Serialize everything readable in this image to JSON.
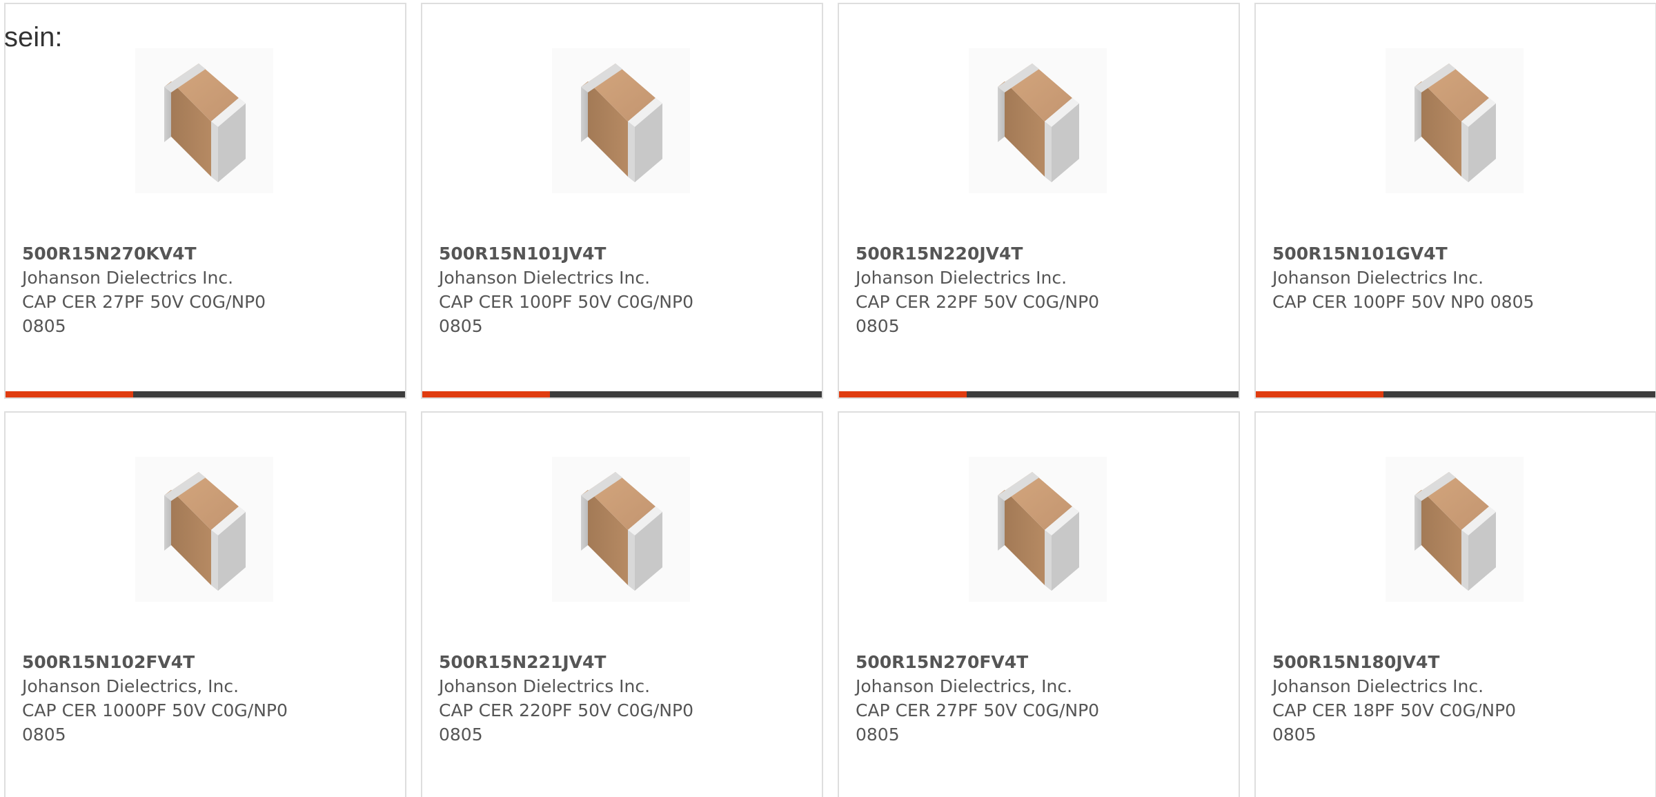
{
  "intro_text": "sein:",
  "colors": {
    "accent": "#e03c10",
    "track": "#3d3d3d",
    "border": "#dedede",
    "text": "#555555"
  },
  "product_image_icon": "ceramic-capacitor-chip",
  "products": [
    {
      "part_number": "500R15N270KV4T",
      "manufacturer": "Johanson Dielectrics Inc.",
      "description": "CAP CER 27PF 50V C0G/NP0 0805",
      "progress_fraction": 0.32
    },
    {
      "part_number": "500R15N101JV4T",
      "manufacturer": "Johanson Dielectrics Inc.",
      "description": "CAP CER 100PF 50V C0G/NP0 0805",
      "progress_fraction": 0.32
    },
    {
      "part_number": "500R15N220JV4T",
      "manufacturer": "Johanson Dielectrics Inc.",
      "description": "CAP CER 22PF 50V C0G/NP0 0805",
      "progress_fraction": 0.32
    },
    {
      "part_number": "500R15N101GV4T",
      "manufacturer": "Johanson Dielectrics Inc.",
      "description": "CAP CER 100PF 50V NP0 0805",
      "progress_fraction": 0.32
    },
    {
      "part_number": "500R15N102FV4T",
      "manufacturer": "Johanson Dielectrics, Inc.",
      "description": "CAP CER 1000PF 50V C0G/NP0 0805"
    },
    {
      "part_number": "500R15N221JV4T",
      "manufacturer": "Johanson Dielectrics Inc.",
      "description": "CAP CER 220PF 50V C0G/NP0 0805"
    },
    {
      "part_number": "500R15N270FV4T",
      "manufacturer": "Johanson Dielectrics, Inc.",
      "description": "CAP CER 27PF 50V C0G/NP0 0805"
    },
    {
      "part_number": "500R15N180JV4T",
      "manufacturer": "Johanson Dielectrics Inc.",
      "description": "CAP CER 18PF 50V C0G/NP0 0805"
    }
  ]
}
